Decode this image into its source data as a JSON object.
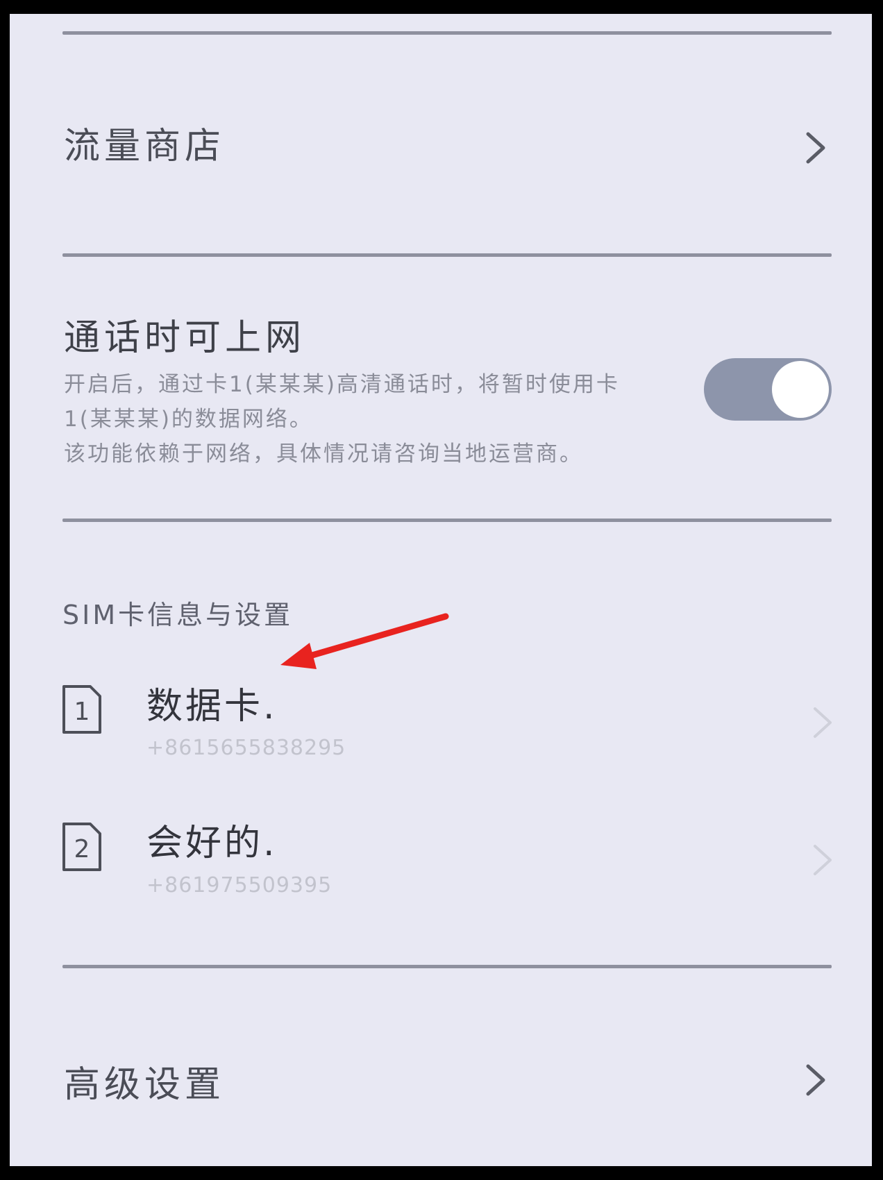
{
  "settings": {
    "traffic_store": {
      "label": "流量商店"
    },
    "call_internet": {
      "title": "通话时可上网",
      "description_lines": [
        "开启后，通过卡1(某某某)高清通话时，将暂时使用卡",
        "1(某某某)的数据网络。",
        "该功能依赖于网络，具体情况请咨询当地运营商。"
      ],
      "toggle_on": true
    },
    "sim_section": {
      "header": "SIM卡信息与设置",
      "cards": [
        {
          "slot": "1",
          "name": "数据卡.",
          "number": "+8615655838295"
        },
        {
          "slot": "2",
          "name": "会好的.",
          "number": "+861975509395"
        }
      ]
    },
    "advanced": {
      "label": "高级设置"
    }
  },
  "colors": {
    "background": "#e8e8f3",
    "divider": "#8e909e",
    "toggle_track": "#8d95ab",
    "annotation_arrow": "#e8231f"
  },
  "icons": {
    "chevron": "chevron-right-icon",
    "sim": "sim-card-icon",
    "annotation": "red-arrow-annotation"
  }
}
